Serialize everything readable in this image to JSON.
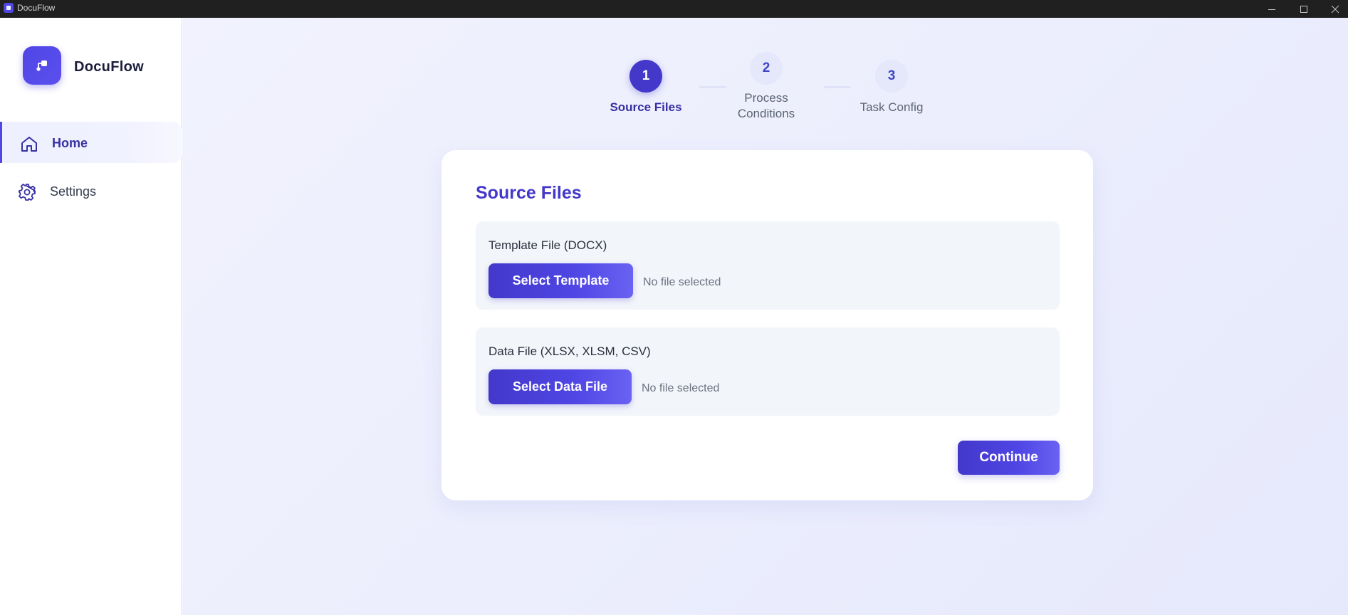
{
  "window": {
    "title": "DocuFlow",
    "controls": [
      "minimize-icon",
      "maximize-icon",
      "close-icon"
    ]
  },
  "sidebar": {
    "brand": "DocuFlow",
    "items": [
      {
        "label": "Home",
        "icon": "home-icon",
        "active": true
      },
      {
        "label": "Settings",
        "icon": "gear-icon",
        "active": false
      }
    ]
  },
  "stepper": {
    "steps": [
      {
        "number": "1",
        "label": "Source Files",
        "active": true
      },
      {
        "number": "2",
        "label": "Process\nConditions",
        "active": false
      },
      {
        "number": "3",
        "label": "Task Config",
        "active": false
      }
    ]
  },
  "card": {
    "title": "Source Files",
    "fields": [
      {
        "label": "Template File (DOCX)",
        "button": "Select Template",
        "status": "No file selected"
      },
      {
        "label": "Data File (XLSX, XLSM, CSV)",
        "button": "Select Data File",
        "status": "No file selected"
      }
    ],
    "continue_label": "Continue"
  },
  "colors": {
    "accent": "#4338ca",
    "accent_light": "#6a62f2",
    "titlebar": "#202020"
  }
}
